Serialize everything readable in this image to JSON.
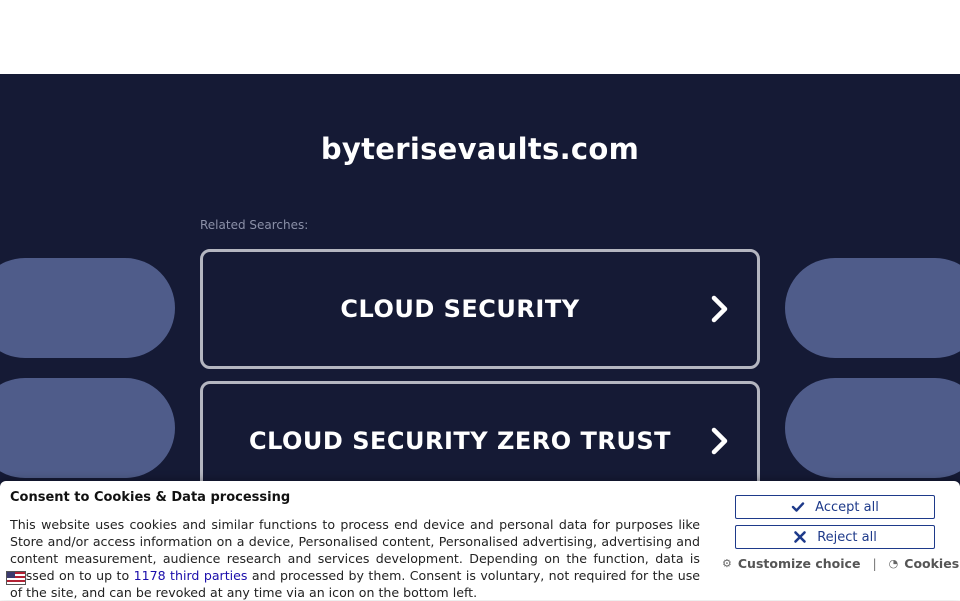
{
  "hero": {
    "domain": "byterisevaults.com",
    "related_label": "Related Searches:",
    "searches": [
      {
        "label": "CLOUD SECURITY"
      },
      {
        "label": "CLOUD SECURITY ZERO TRUST"
      }
    ]
  },
  "consent": {
    "title": "Consent to Cookies & Data processing",
    "text_before_link": "This website uses cookies and similar functions to process end device and personal data for purposes like Store and/or access information on a device, Personalised content, Personalised advertising, advertising and content measurement, audience research and services development. Depending on the function, data is passed on to up to ",
    "link_text": "1178 third parties",
    "text_after_link": " and processed by them. Consent is voluntary, not required for the use of the site, and can be revoked at any time via an icon on the bottom left.",
    "accept_label": "Accept all",
    "reject_label": "Reject all",
    "customize_label": "Customize choice",
    "separator": "|",
    "cookies_label": "Cookies"
  },
  "colors": {
    "hero_bg": "#151a35",
    "pill": "#4f5c8a",
    "button_border": "#b4b6c0",
    "consent_accent": "#1e3a8a"
  }
}
